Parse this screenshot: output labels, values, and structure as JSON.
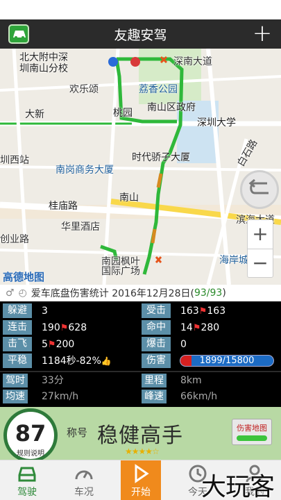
{
  "header": {
    "title": "友趣安驾",
    "plus": "+"
  },
  "map": {
    "labels": [
      {
        "text": "北大附中深",
        "cls": "dk"
      },
      {
        "text": "圳南山分校",
        "cls": "dk"
      },
      {
        "text": "欢乐颂",
        "cls": ""
      },
      {
        "text": "大新",
        "cls": "dk"
      },
      {
        "text": "桃园",
        "cls": "dk"
      },
      {
        "text": "荔香公园",
        "cls": "b"
      },
      {
        "text": "南山区政府",
        "cls": "dk"
      },
      {
        "text": "深南大道",
        "cls": ""
      },
      {
        "text": "深圳大学",
        "cls": "dk"
      },
      {
        "text": "时代骄子大厦",
        "cls": "dk"
      },
      {
        "text": "圳西站",
        "cls": ""
      },
      {
        "text": "南岗商务大厦",
        "cls": "b"
      },
      {
        "text": "南山",
        "cls": "dk"
      },
      {
        "text": "桂庙路",
        "cls": "dk"
      },
      {
        "text": "华里酒店",
        "cls": ""
      },
      {
        "text": "创业路",
        "cls": ""
      },
      {
        "text": "南园枫叶",
        "cls": ""
      },
      {
        "text": "国际广场",
        "cls": ""
      },
      {
        "text": "滨海大道",
        "cls": ""
      },
      {
        "text": "海岸城",
        "cls": "b"
      },
      {
        "text": "白石路",
        "cls": ""
      }
    ],
    "logo": "高德地图",
    "zoom_in": "+",
    "zoom_out": "−"
  },
  "stats_line": {
    "gender_icon": "♂",
    "prefix": "爱车底盘伤害统计 2016年12月28日(",
    "count": "93/93",
    ")": ")",
    "suffix": ")"
  },
  "stats": {
    "dodge": {
      "label": "躲避",
      "value": "3"
    },
    "hit_taken": {
      "label": "受击",
      "value": "163",
      "value2": "163"
    },
    "combo": {
      "label": "连击",
      "value": "190",
      "value2": "628"
    },
    "hit": {
      "label": "命中",
      "value": "14",
      "value2": "280"
    },
    "knock": {
      "label": "击飞",
      "value": "5",
      "value2": "200"
    },
    "crit": {
      "label": "爆击",
      "value": "0"
    },
    "stable": {
      "label": "平稳",
      "value": "1184秒-82%"
    },
    "damage": {
      "label": "伤害",
      "value": "1899/15800",
      "fraction": 0.12
    }
  },
  "trip": {
    "duration": {
      "label": "驾时",
      "value": "33分"
    },
    "distance": {
      "label": "里程",
      "value": "8km"
    },
    "avg_speed": {
      "label": "均速",
      "value": "27km/h"
    },
    "peak_speed": {
      "label": "峰速",
      "value": "66km/h"
    }
  },
  "profile": {
    "score": "87",
    "score_sub": "规则说明",
    "nick_label": "称号",
    "nick": "稳健高手",
    "stars": "★★★★☆",
    "damage_map": "伤害地图"
  },
  "tabs": [
    {
      "label": "驾驶",
      "icon": "car-icon"
    },
    {
      "label": "车况",
      "icon": "gauge-icon"
    },
    {
      "label": "开始",
      "icon": "play-icon"
    },
    {
      "label": "今天",
      "icon": "clock-icon"
    },
    {
      "label": "我的",
      "icon": "user-icon"
    }
  ],
  "watermark": "大玩客",
  "colors": {
    "title_bg": "#2b2b2b",
    "label_bg": "#5c8fa8",
    "tab_active": "#f08a1c",
    "profile_bg": "#b8d9a4",
    "route": "#2fb83a"
  }
}
